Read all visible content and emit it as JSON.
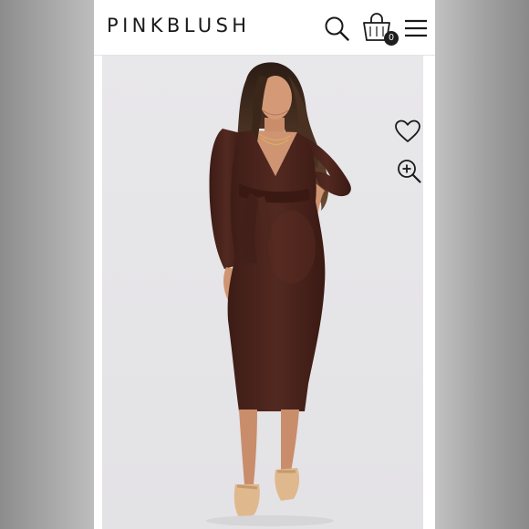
{
  "header": {
    "brand": "PINKBLUSH",
    "cart_count": "0",
    "icons": [
      "search-icon",
      "shopping-bag-icon",
      "menu-icon"
    ]
  },
  "product_image": {
    "description_icons": [
      "heart-icon",
      "zoom-in-icon"
    ]
  },
  "colors": {
    "dress": "#4a231c",
    "background": "#e6e5e8",
    "header": "#ffffff",
    "backdrop": "#bdbdbd"
  }
}
